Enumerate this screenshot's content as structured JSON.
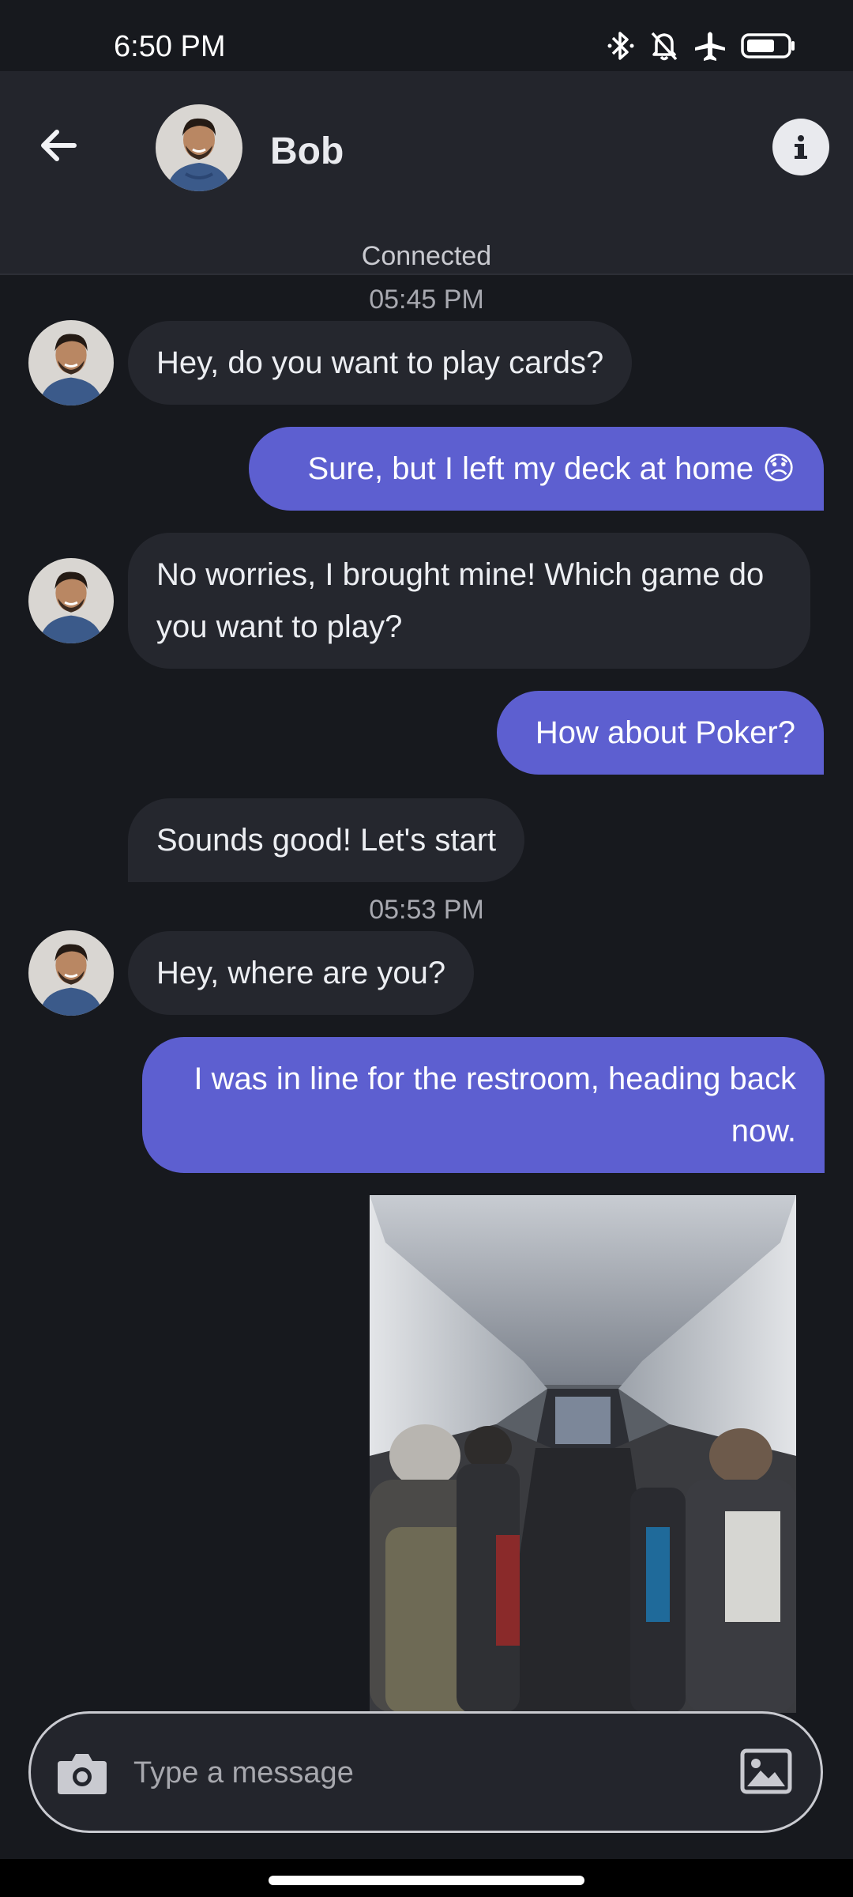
{
  "status_bar": {
    "time": "6:50 PM",
    "icons": [
      "bluetooth-icon",
      "bell-off-icon",
      "airplane-mode-icon",
      "battery-icon"
    ]
  },
  "header": {
    "contact_name": "Bob",
    "connection_status": "Connected",
    "back_icon": "arrow-left-icon",
    "info_icon": "info-icon"
  },
  "messages": [
    {
      "type": "timestamp",
      "text": "05:45 PM"
    },
    {
      "type": "in",
      "text": "Hey, do you want to play cards?",
      "avatar": true
    },
    {
      "type": "out",
      "text": "Sure, but I left my deck at home 😞"
    },
    {
      "type": "in",
      "text": "No worries, I brought mine! Which game do you want to play?",
      "avatar": true
    },
    {
      "type": "out",
      "text": "How about Poker?"
    },
    {
      "type": "in",
      "text": "Sounds good! Let's start",
      "avatar": false
    },
    {
      "type": "timestamp",
      "text": "05:53 PM"
    },
    {
      "type": "in",
      "text": "Hey, where are you?",
      "avatar": true
    },
    {
      "type": "out",
      "text": "I was in line for the restroom, heading back now."
    },
    {
      "type": "image",
      "subject": "airplane cabin aisle"
    }
  ],
  "composer": {
    "placeholder": "Type a message",
    "value": "",
    "left_icon": "camera-icon",
    "right_icon": "image-gallery-icon"
  },
  "colors": {
    "background": "#17191e",
    "header": "#23252c",
    "incoming_bubble": "#25272e",
    "outgoing_bubble": "#5d5fd0",
    "text": "#e8e9ee"
  }
}
